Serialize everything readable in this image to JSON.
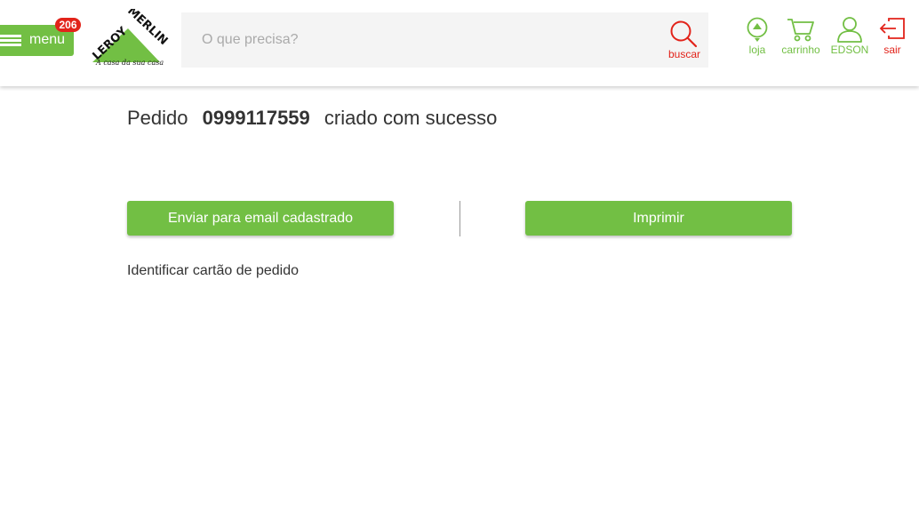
{
  "header": {
    "menu": {
      "label": "menu",
      "badge": "206"
    },
    "logo": {
      "brand_text": "LEROY MERLIN",
      "tagline": "A casa da sua casa"
    },
    "search": {
      "placeholder": "O que precisa?",
      "button_label": "buscar"
    },
    "nav": {
      "store_label": "loja",
      "cart_label": "carrinho",
      "user_label": "EDSON",
      "logout_label": "sair"
    }
  },
  "main": {
    "title_prefix": "Pedido",
    "order_number": "0999117559",
    "title_suffix": "criado com sucesso",
    "email_button_label": "Enviar para email cadastrado",
    "print_button_label": "Imprimir",
    "identify_link_label": "Identificar cartão de pedido"
  },
  "colors": {
    "brand_green": "#72bf44",
    "accent_red": "#e2231a",
    "text": "#333333",
    "search_bg": "#f4f4f4"
  },
  "icons": [
    "hamburger-icon",
    "search-icon",
    "store-location-icon",
    "cart-icon",
    "user-icon",
    "logout-icon"
  ]
}
